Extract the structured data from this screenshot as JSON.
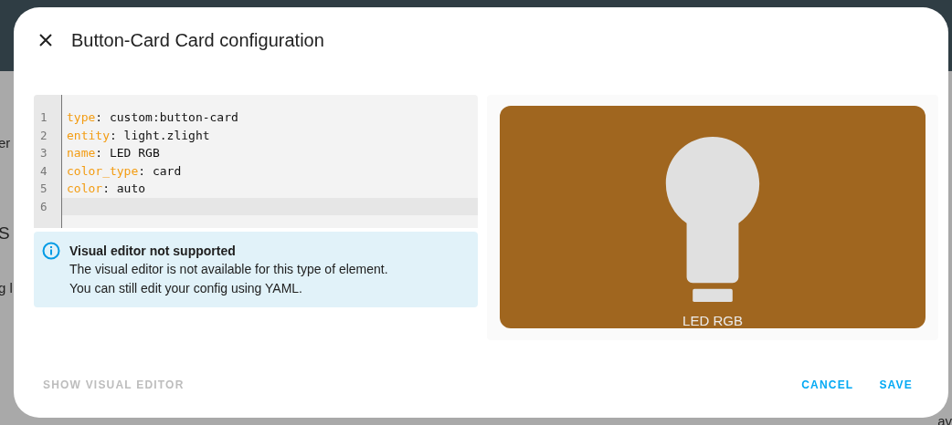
{
  "background": {
    "left_fragments": [
      "er",
      "S",
      "g l"
    ],
    "right_fragments": [
      "av"
    ]
  },
  "dialog": {
    "title": "Button-Card Card configuration",
    "editor": {
      "lines": [
        {
          "number": "1",
          "key": "type",
          "value": ": custom:button-card",
          "active": false
        },
        {
          "number": "2",
          "key": "entity",
          "value": ": light.zlight",
          "active": false
        },
        {
          "number": "3",
          "key": "name",
          "value": ": LED RGB",
          "active": false
        },
        {
          "number": "4",
          "key": "color_type",
          "value": ": card",
          "active": false
        },
        {
          "number": "5",
          "key": "color",
          "value": ": auto",
          "active": false
        },
        {
          "number": "6",
          "active": true
        }
      ]
    },
    "alert": {
      "title": "Visual editor not supported",
      "lines": [
        "The visual editor is not available for this type of element.",
        "You can still edit your config using YAML."
      ]
    },
    "preview": {
      "name": "LED RGB",
      "color": "#a0661f"
    },
    "footer": {
      "toggle": {
        "label": "SHOW VISUAL EDITOR",
        "disabled": true
      },
      "actions": [
        "CANCEL",
        "SAVE"
      ]
    }
  }
}
